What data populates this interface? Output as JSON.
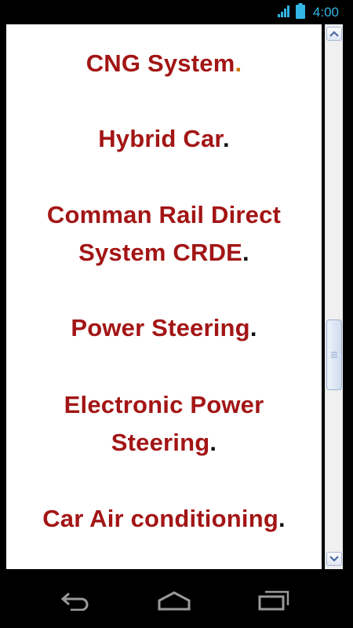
{
  "status_bar": {
    "time": "4:00",
    "time_color": "#33b5e5"
  },
  "topics": [
    {
      "line1": "CNG System",
      "line2": "",
      "period": ".",
      "period_color": "orange"
    },
    {
      "line1": "Hybrid Car",
      "line2": "",
      "period": ".",
      "period_color": "black"
    },
    {
      "line1": "Comman Rail Direct",
      "line2": "System CRDE",
      "period": ".",
      "period_color": "black"
    },
    {
      "line1": "Power Steering",
      "line2": "",
      "period": ".",
      "period_color": "black"
    },
    {
      "line1": "Electronic Power",
      "line2": "Steering",
      "period": ".",
      "period_color": "black"
    },
    {
      "line1": "Car Air conditioning",
      "line2": "",
      "period": ".",
      "period_color": "black"
    }
  ],
  "colors": {
    "topic_text": "#a31515",
    "background": "#ffffff",
    "accent": "#33b5e5"
  },
  "icons": {
    "signal": "signal-icon",
    "battery": "battery-icon",
    "back": "back-icon",
    "home": "home-icon",
    "recents": "recent-apps-icon",
    "scroll_up": "chevron-up-icon",
    "scroll_down": "chevron-down-icon"
  }
}
